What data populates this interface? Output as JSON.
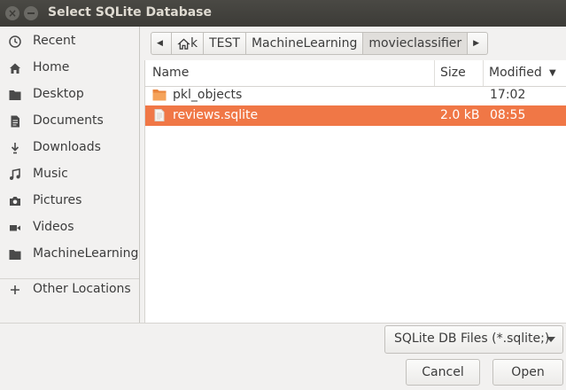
{
  "window": {
    "title": "Select SQLite Database",
    "close_glyph": "×"
  },
  "sidebar": {
    "items": [
      {
        "label": "Recent",
        "icon": "clock-icon"
      },
      {
        "label": "Home",
        "icon": "home-icon"
      },
      {
        "label": "Desktop",
        "icon": "folder-icon"
      },
      {
        "label": "Documents",
        "icon": "document-icon"
      },
      {
        "label": "Downloads",
        "icon": "download-icon"
      },
      {
        "label": "Music",
        "icon": "music-icon"
      },
      {
        "label": "Pictures",
        "icon": "camera-icon"
      },
      {
        "label": "Videos",
        "icon": "video-icon"
      },
      {
        "label": "MachineLearning",
        "icon": "folder-icon"
      }
    ],
    "other_locations": {
      "label": "Other Locations",
      "icon": "plus-icon"
    }
  },
  "pathbar": {
    "back_glyph": "◀",
    "home_label": "k",
    "crumbs": [
      "TEST",
      "MachineLearning",
      "movieclassifier"
    ],
    "forward_glyph": "▶"
  },
  "filelist": {
    "columns": {
      "name": "Name",
      "size": "Size",
      "modified": "Modified",
      "sort_glyph": "▼"
    },
    "rows": [
      {
        "name": "pkl_objects",
        "size": "",
        "modified": "17:02",
        "icon": "folder-icon",
        "selected": false
      },
      {
        "name": "reviews.sqlite",
        "size": "2.0 kB",
        "modified": "08:55",
        "icon": "file-icon",
        "selected": true
      }
    ]
  },
  "filter": {
    "label": "SQLite DB Files (*.sqlite;)"
  },
  "buttons": {
    "cancel": "Cancel",
    "open": "Open"
  },
  "colors": {
    "selection": "#f07746",
    "titlebar": "#3c3b37"
  }
}
